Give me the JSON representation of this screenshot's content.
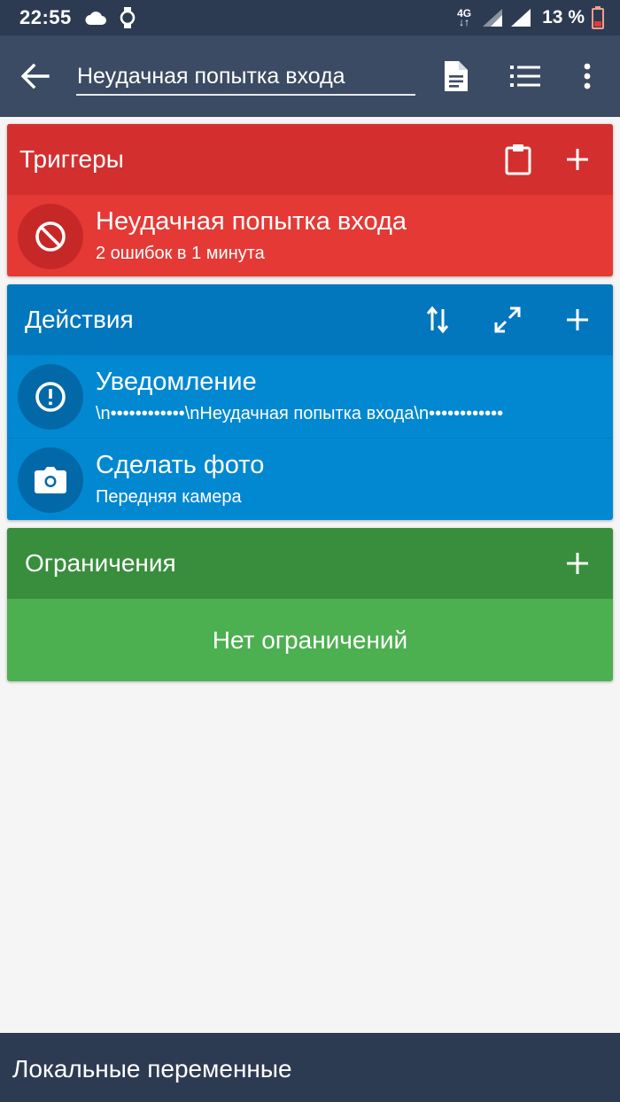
{
  "status_bar": {
    "time": "22:55",
    "network_type": "4G",
    "battery_text": "13 %",
    "icons": [
      "cloud-icon",
      "watch-icon",
      "signal-icon",
      "battery-low-icon"
    ]
  },
  "app_bar": {
    "title_value": "Неудачная попытка входа",
    "icons": [
      "back-arrow-icon",
      "document-icon",
      "list-icon",
      "more-vert-icon"
    ]
  },
  "triggers": {
    "title": "Триггеры",
    "items": [
      {
        "title": "Неудачная попытка входа",
        "subtitle": "2 ошибок в 1 минута",
        "icon": "block-icon"
      }
    ],
    "color": "#e53935",
    "header_color": "#d32f2f"
  },
  "actions": {
    "title": "Действия",
    "items": [
      {
        "title": "Уведомление",
        "subtitle": "\\n••••••••••••\\nНеудачная попытка входа\\n••••••••••••",
        "icon": "alert-circle-icon"
      },
      {
        "title": "Сделать фото",
        "subtitle": "Передняя камера",
        "icon": "camera-icon"
      }
    ],
    "color": "#0288d1",
    "header_color": "#0277bd"
  },
  "constraints": {
    "title": "Ограничения",
    "empty_text": "Нет ограничений",
    "color": "#4caf50",
    "header_color": "#388e3c"
  },
  "bottom_bar": {
    "label": "Локальные переменные"
  }
}
